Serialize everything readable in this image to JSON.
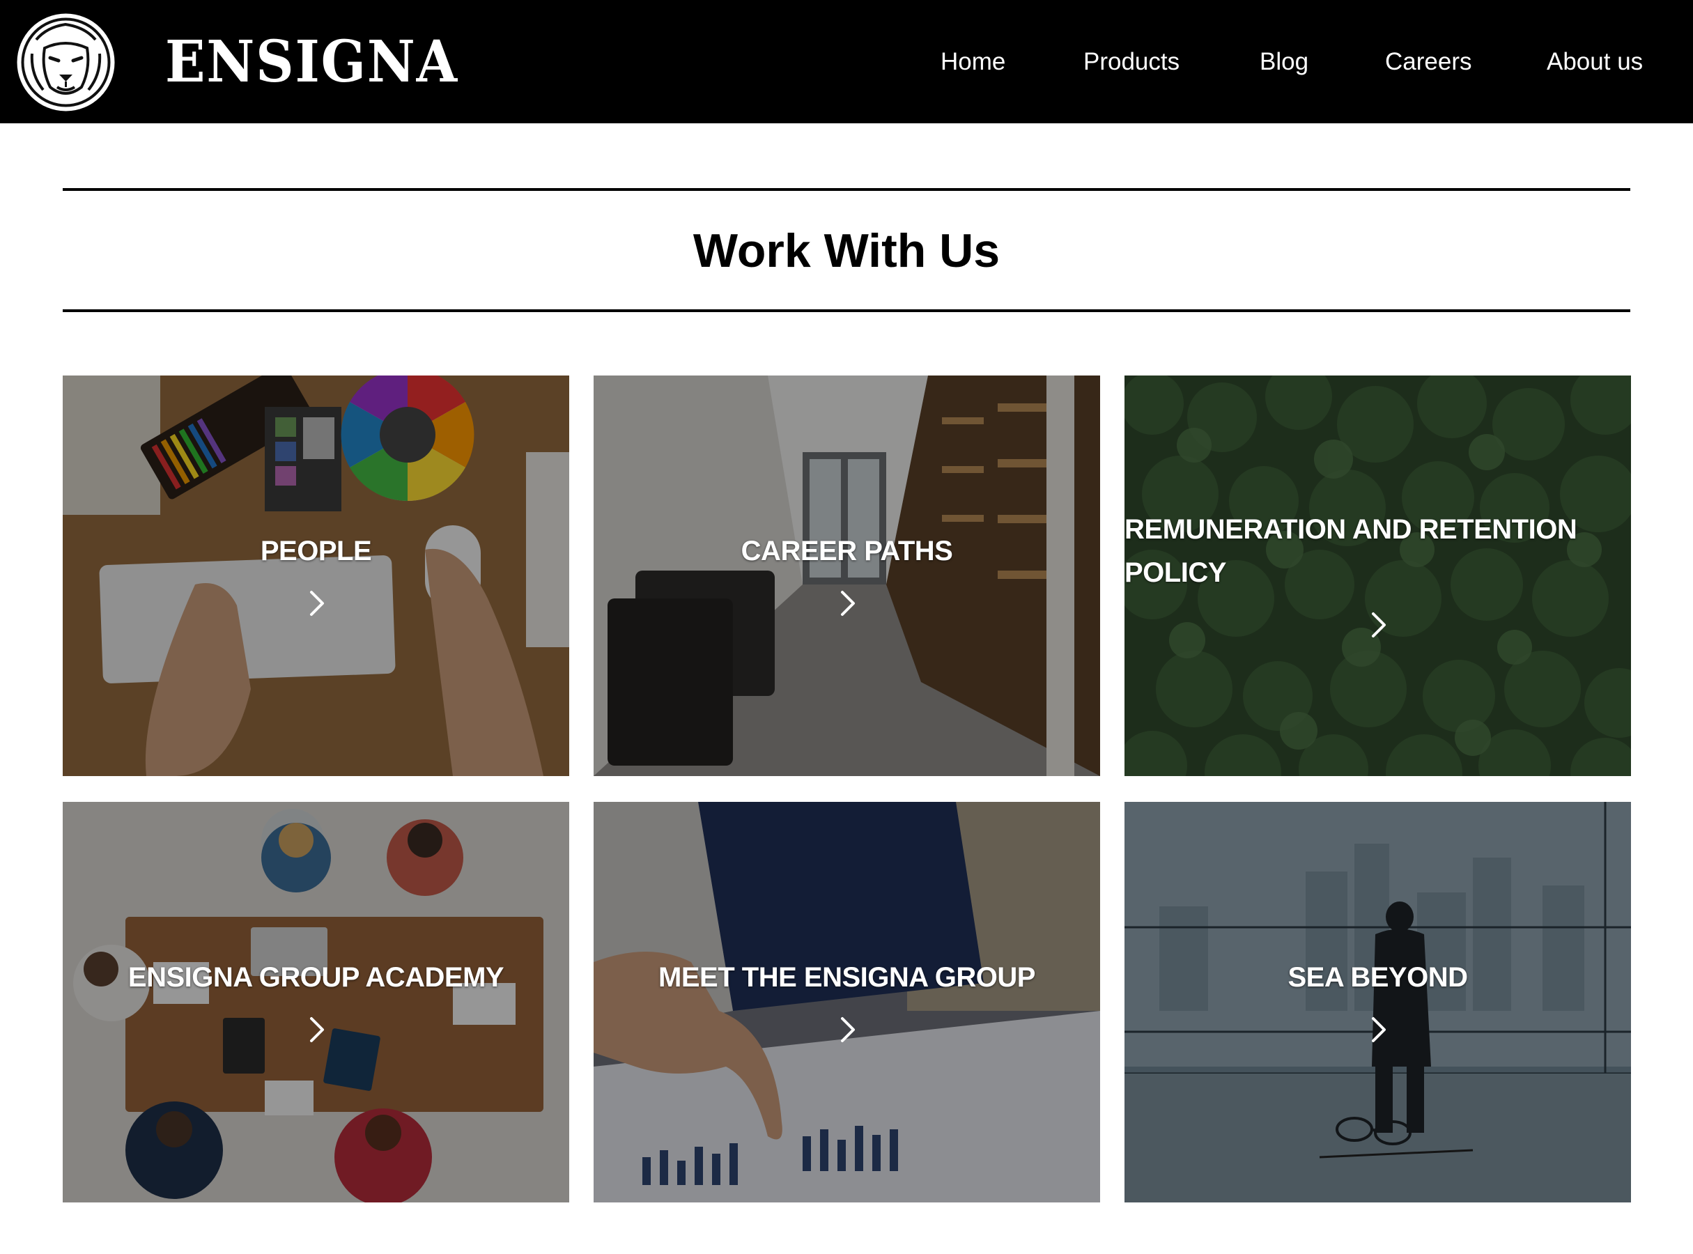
{
  "header": {
    "brand": "ENSIGNA",
    "logo_icon": "lion-head-icon",
    "nav": [
      {
        "label": "Home"
      },
      {
        "label": "Products"
      },
      {
        "label": "Blog"
      },
      {
        "label": "Careers"
      },
      {
        "label": "About us"
      }
    ]
  },
  "main": {
    "title": "Work With Us",
    "cards": [
      {
        "label": "PEOPLE",
        "image": "desk-keyboard-color-wheel-photo",
        "icon": "chevron-right-icon"
      },
      {
        "label": "CAREER PATHS",
        "image": "office-library-corridor-photo",
        "icon": "chevron-right-icon"
      },
      {
        "label": "REMUNERATION AND RETENTION POLICY",
        "image": "aerial-forest-photo",
        "icon": "chevron-right-icon"
      },
      {
        "label": "ENSIGNA GROUP ACADEMY",
        "image": "team-meeting-table-photo",
        "icon": "chevron-right-icon"
      },
      {
        "label": "MEET THE ENSIGNA GROUP",
        "image": "hand-pointing-chart-photo",
        "icon": "chevron-right-icon"
      },
      {
        "label": "SEA BEYOND",
        "image": "man-window-city-photo",
        "icon": "chevron-right-icon"
      }
    ]
  },
  "colors": {
    "header_bg": "#000000",
    "page_bg": "#ffffff",
    "text_on_dark": "#ffffff"
  }
}
